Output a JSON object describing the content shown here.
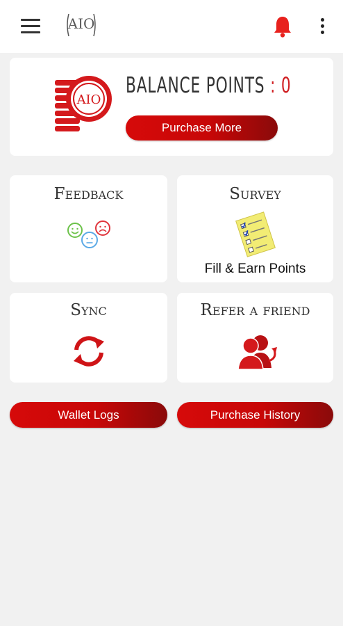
{
  "appbar": {
    "menu_icon": "hamburger-menu-icon",
    "logo_text": "AIO",
    "notification_icon": "bell-icon",
    "overflow_icon": "more-vertical-icon"
  },
  "balance": {
    "label": "BALANCE POINTS",
    "separator": ":",
    "value": "0",
    "purchase_more_label": "Purchase More"
  },
  "tiles": {
    "feedback": {
      "title": "Feedback",
      "icon": "smiley-faces-icon"
    },
    "survey": {
      "title": "Survey",
      "icon": "survey-checklist-icon",
      "caption": "Fill & Earn Points"
    },
    "sync": {
      "title": "Sync",
      "icon": "sync-arrows-icon"
    },
    "refer": {
      "title": "Refer a friend",
      "icon": "people-share-icon"
    }
  },
  "buttons": {
    "wallet_logs": "Wallet Logs",
    "purchase_history": "Purchase History"
  },
  "colors": {
    "accent": "#c70707",
    "accent_dark": "#8a0a0a",
    "background": "#f1f1f1",
    "card": "#ffffff"
  }
}
